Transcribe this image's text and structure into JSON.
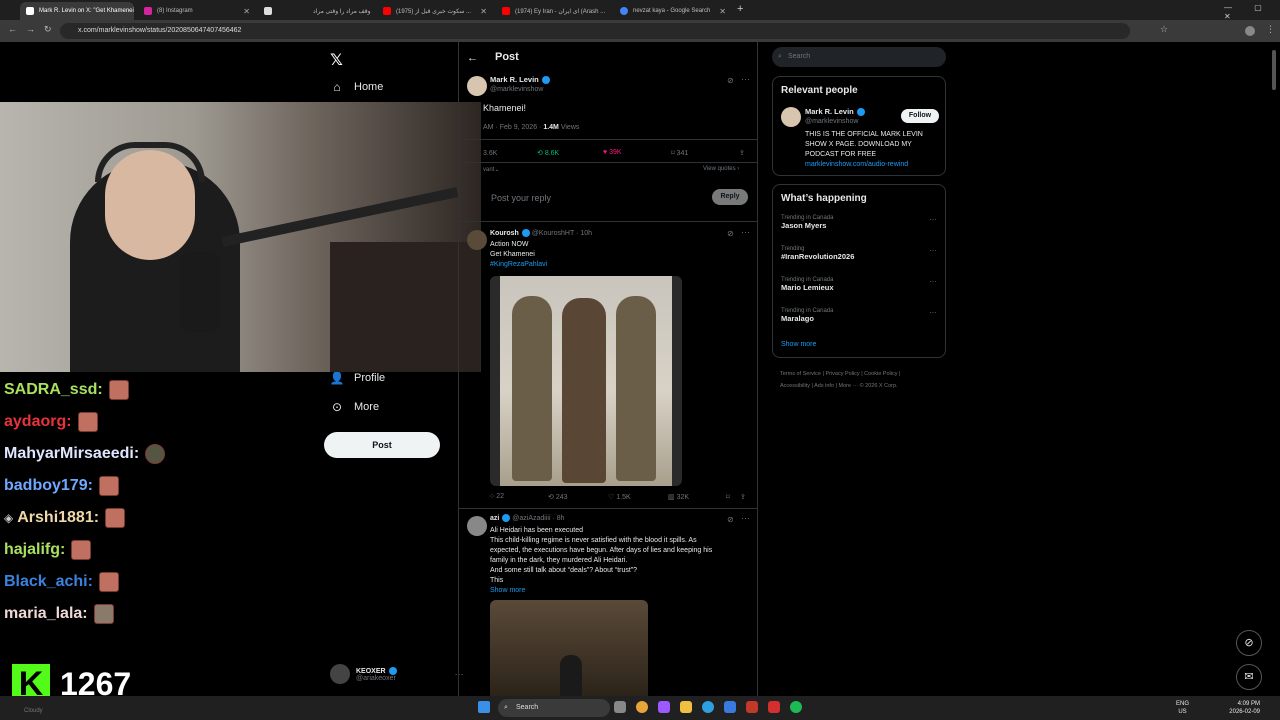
{
  "browser": {
    "tabs": [
      {
        "label": "Mark R. Levin on X: \"Get Khamenei",
        "active": true,
        "color": "#ffffff"
      },
      {
        "label": "(8) Instagram",
        "active": false,
        "color": "#d6249f"
      },
      {
        "label": "وقف مراد را وقتی مراد",
        "active": false,
        "color": "#dddddd"
      },
      {
        "label": "(1975) سکوت خبری قبل از ...",
        "active": false,
        "color": "#ff0000"
      },
      {
        "label": "(1974) Ey Iran - ای ایران (Arash ...",
        "active": false,
        "color": "#ff0000"
      },
      {
        "label": "nevzat kaya - Google Search",
        "active": false,
        "color": "#4285f4"
      }
    ],
    "url": "x.com/marklevinshow/status/2020850647407456462"
  },
  "nav": {
    "home": "Home",
    "profile": "Profile",
    "more": "More",
    "post": "Post",
    "account_name": "KEOXER",
    "account_handle": "@ariakeoxer"
  },
  "chat": [
    {
      "user": "SADRA_ssd:",
      "color": "#a8e05f"
    },
    {
      "user": "aydaorg:",
      "color": "#e8323c"
    },
    {
      "user": "MahyarMirsaeedi:",
      "color": "#e0e6ff"
    },
    {
      "user": "badboy179:",
      "color": "#6fa8ff"
    },
    {
      "user": "Arshi1881:",
      "color": "#f0d8a8"
    },
    {
      "user": "hajalifg:",
      "color": "#a8e05f"
    },
    {
      "user": "Black_achi:",
      "color": "#3a82e0"
    },
    {
      "user": "maria_lala:",
      "color": "#f0d8d8"
    }
  ],
  "kick": {
    "logo": "K",
    "count": "1267"
  },
  "main": {
    "header": "Post",
    "author_name": "Mark R. Levin",
    "author_handle": "@marklevinshow",
    "text": "Khamenei!",
    "meta": "AM · Feb 9, 2026 ·",
    "views": "1.4M",
    "views_label": "Views",
    "stats": {
      "replies": "3.6K",
      "reposts": "8.6K",
      "likes": "39K",
      "bookmarks": "341"
    },
    "relevant_label": "vant",
    "view_quotes": "View quotes",
    "reply_placeholder": "Post your reply",
    "reply_btn": "Reply",
    "reply1": {
      "name": "Kourosh",
      "handle": "@KouroshHT · 10h",
      "line1": "Action NOW",
      "line2": "Get Khamenei",
      "hashtag": "#KingRezaPahlavi",
      "stats": {
        "replies": "22",
        "reposts": "243",
        "likes": "1.5K",
        "views": "32K"
      }
    },
    "reply2": {
      "name": "azi",
      "handle": "@aziAzadiiii · 8h",
      "lines": [
        "Ali Heidari has been executed",
        "This child-killing regime is never satisfied with the blood it spills. As",
        "expected, the executions have begun. After days of lies and keeping his",
        "family in the dark, they murdered Ali Heidari.",
        "And some still talk about “deals”? About “trust”?",
        "This"
      ],
      "show_more": "Show more"
    }
  },
  "right": {
    "search_placeholder": "Search",
    "relevant_title": "Relevant people",
    "person_name": "Mark R. Levin",
    "person_handle": "@marklevinshow",
    "follow": "Follow",
    "bio": [
      "THIS IS THE OFFICIAL MARK LEVIN",
      "SHOW X PAGE. DOWNLOAD MY",
      "PODCAST FOR FREE"
    ],
    "bio_link": "marklevinshow.com/audio-rewind",
    "happening_title": "What’s happening",
    "trends": [
      {
        "sub": "Trending in Canada",
        "name": "Jason Myers"
      },
      {
        "sub": "Trending",
        "name": "#IranRevolution2026"
      },
      {
        "sub": "Trending in Canada",
        "name": "Mario Lemieux"
      },
      {
        "sub": "Trending in Canada",
        "name": "Maralago"
      }
    ],
    "show_more": "Show more",
    "footer1": "Terms of Service  |  Privacy Policy  |  Cookie Policy  |",
    "footer2": "Accessibility  |  Ads info  |  More ···  © 2026 X Corp."
  },
  "taskbar": {
    "search": "Search",
    "lang1": "ENG",
    "lang2": "US",
    "time": "4:09 PM",
    "date": "2026-02-09",
    "weather": "Cloudy"
  }
}
